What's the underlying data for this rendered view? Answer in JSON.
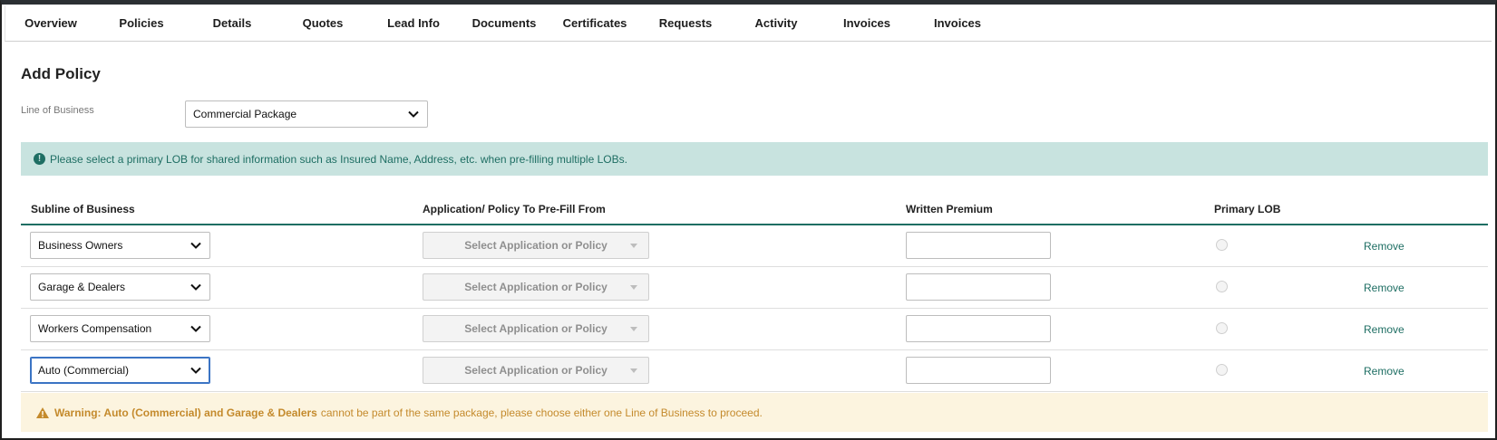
{
  "tabs": [
    {
      "label": "Overview"
    },
    {
      "label": "Policies"
    },
    {
      "label": "Details"
    },
    {
      "label": "Quotes"
    },
    {
      "label": "Lead Info"
    },
    {
      "label": "Documents"
    },
    {
      "label": "Certificates"
    },
    {
      "label": "Requests"
    },
    {
      "label": "Activity"
    },
    {
      "label": "Invoices"
    },
    {
      "label": "Invoices"
    }
  ],
  "page": {
    "title": "Add Policy"
  },
  "line_of_business": {
    "label": "Line of Business",
    "value": "Commercial Package"
  },
  "info_banner": {
    "icon": "info-circle-icon",
    "text": "Please select a primary LOB for shared information such as Insured Name, Address, etc. when pre-filling multiple LOBs."
  },
  "table": {
    "headers": {
      "subline": "Subline of Business",
      "application": "Application/ Policy To Pre-Fill From",
      "premium": "Written Premium",
      "primary": "Primary LOB"
    },
    "rows": [
      {
        "subline": "Business Owners",
        "application_placeholder": "Select Application or Policy",
        "premium": "",
        "primary": false,
        "remove_label": "Remove"
      },
      {
        "subline": "Garage & Dealers",
        "application_placeholder": "Select Application or Policy",
        "premium": "",
        "primary": false,
        "remove_label": "Remove"
      },
      {
        "subline": "Workers Compensation",
        "application_placeholder": "Select Application or Policy",
        "premium": "",
        "primary": false,
        "remove_label": "Remove"
      },
      {
        "subline": "Auto (Commercial)",
        "application_placeholder": "Select Application or Policy",
        "premium": "",
        "primary": false,
        "remove_label": "Remove"
      }
    ]
  },
  "warning": {
    "icon": "warning-triangle-icon",
    "bold_text": "Warning: Auto (Commercial) and Garage & Dealers",
    "text": "cannot be part of the same package, please choose either one Line of Business to proceed."
  },
  "colors": {
    "accent": "#1e6e63",
    "info_bg": "#c8e3df",
    "warning_bg": "#fcf4df",
    "warning_text": "#c48a2c"
  }
}
